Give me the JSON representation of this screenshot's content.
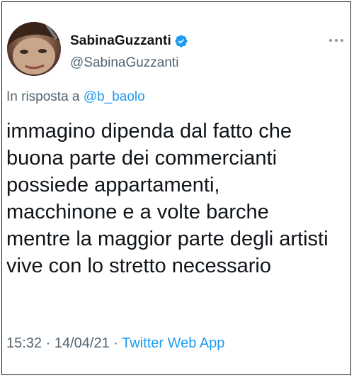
{
  "user": {
    "display_name": "SabinaGuzzanti",
    "handle": "@SabinaGuzzanti",
    "verified_icon": "verified-badge-icon",
    "avatar_icon": "profile-photo"
  },
  "reply": {
    "prefix": "In risposta a",
    "handle": "@b_baolo"
  },
  "tweet": {
    "text": "immagino dipenda dal fatto che\nbuona parte dei commercianti\npossiede appartamenti,\nmacchinone e a volte barche\nmentre la maggior parte degli artisti\nvive con lo stretto necessario"
  },
  "meta": {
    "time": "15:32",
    "separator": "·",
    "date": "14/04/21",
    "source": "Twitter Web App"
  },
  "colors": {
    "accent": "#1d9bf0",
    "text": "#0f1419",
    "muted": "#536471"
  },
  "icons": {
    "more": "more-options-icon"
  }
}
